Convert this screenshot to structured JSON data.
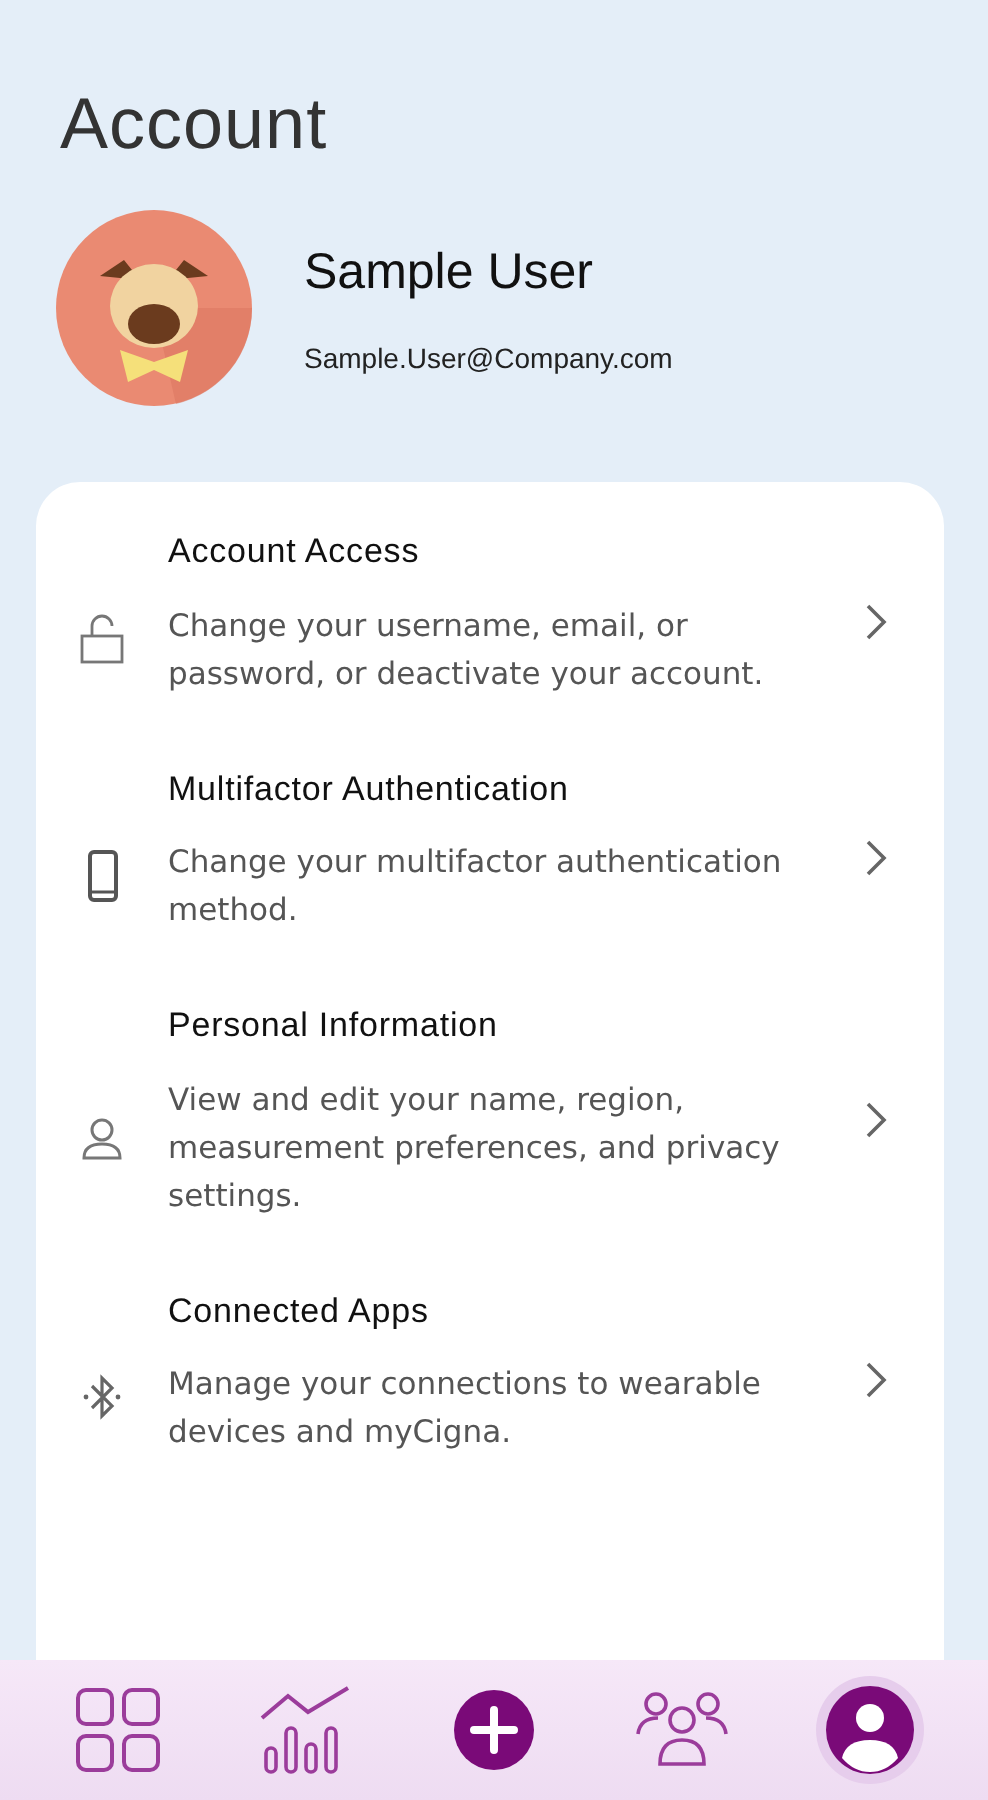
{
  "title": "Account",
  "profile": {
    "name": "Sample User",
    "email": "Sample.User@Company.com"
  },
  "items": [
    {
      "kind": "lock",
      "title": "Account Access",
      "description": "Change your username, email, or password, or deactivate your account."
    },
    {
      "kind": "phone",
      "title": "Multifactor Authentication",
      "description": "Change your multifactor authentication method."
    },
    {
      "kind": "person",
      "title": "Personal Information",
      "description": "View and edit your name, region, measurement preferences, and privacy settings."
    },
    {
      "kind": "bluetooth",
      "title": "Connected Apps",
      "description": "Manage your connections to wearable devices and myCigna."
    }
  ],
  "nav": [
    {
      "kind": "dashboard",
      "selected": false
    },
    {
      "kind": "progress",
      "selected": false
    },
    {
      "kind": "add",
      "selected": false
    },
    {
      "kind": "community",
      "selected": false
    },
    {
      "kind": "profile",
      "selected": true
    }
  ]
}
